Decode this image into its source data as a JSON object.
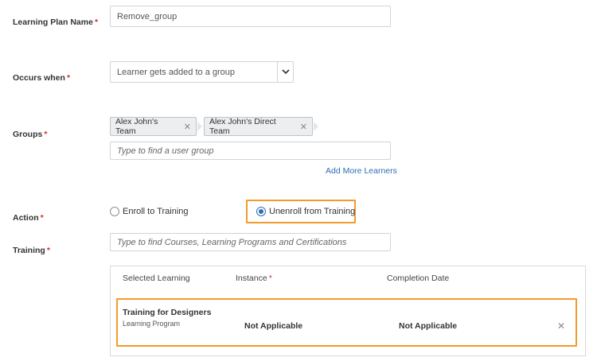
{
  "form": {
    "name_label": "Learning Plan Name",
    "name_value": "Remove_group",
    "occurs_label": "Occurs when",
    "occurs_value": "Learner gets added to a group",
    "groups_label": "Groups",
    "group_chips": [
      "Alex John's Team",
      "Alex John's Direct Team"
    ],
    "group_placeholder": "Type to find a user group",
    "add_more": "Add More Learners",
    "action_label": "Action",
    "action_options": [
      "Enroll to Training",
      "Unenroll from Training"
    ],
    "action_selected": "Unenroll from Training",
    "training_label": "Training",
    "training_placeholder": "Type to find Courses, Learning Programs and Certifications",
    "required_mark": "*"
  },
  "table": {
    "headers": [
      "Selected Learning",
      "Instance",
      "Completion Date"
    ],
    "instance_required": "*",
    "rows": [
      {
        "title": "Training for Designers",
        "type": "Learning Program",
        "instance": "Not Applicable",
        "completion": "Not Applicable"
      }
    ]
  },
  "icons": {
    "chip_remove": "close-icon",
    "dropdown": "chevron-down-icon",
    "row_remove": "close-icon"
  },
  "colors": {
    "accent": "#2d6db4",
    "highlight": "#f39a2d",
    "required": "#d32f2f"
  }
}
